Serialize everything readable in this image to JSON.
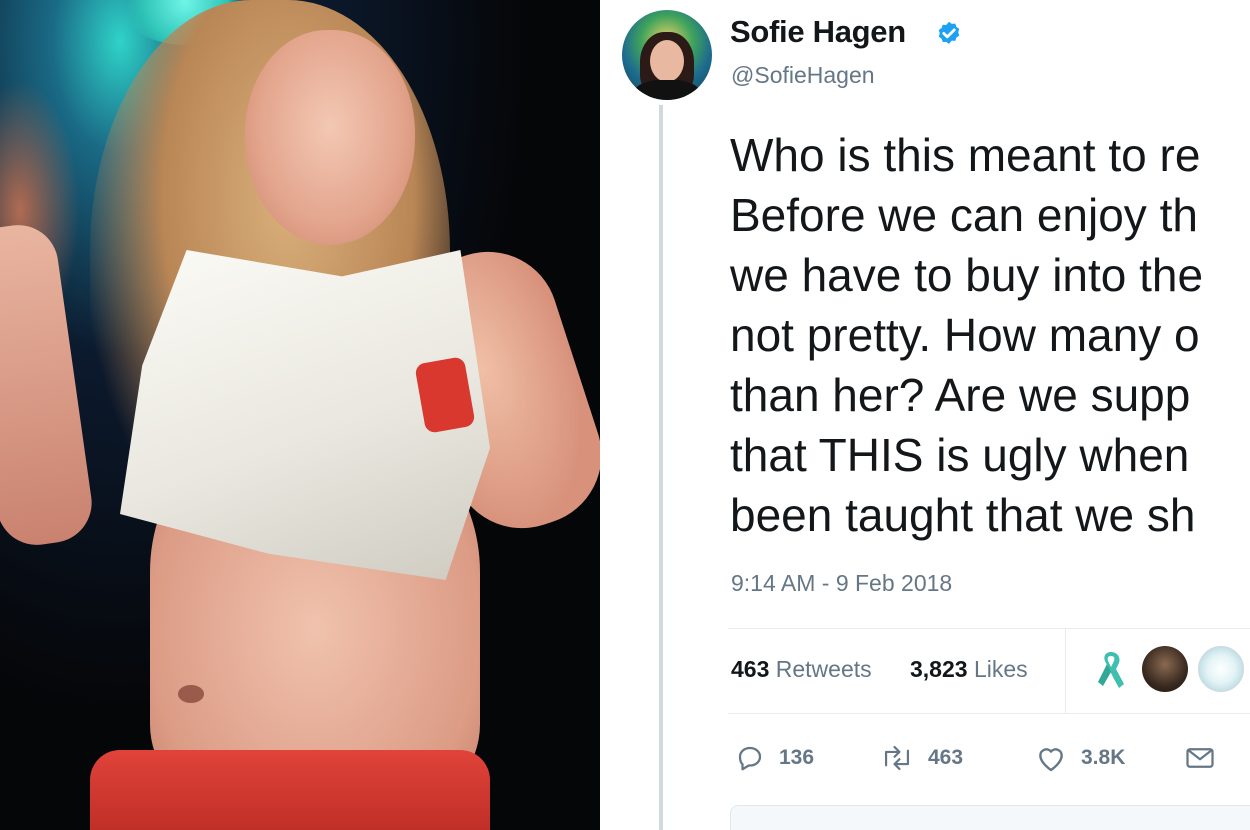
{
  "tweet": {
    "author_name": "Sofie Hagen",
    "author_handle": "@SofieHagen",
    "verified": true,
    "text_lines": [
      "Who is this meant to re",
      "Before we can enjoy th",
      "we have to buy into the",
      "not pretty. How many o",
      "than her? Are we supp",
      "that THIS is ugly when",
      "been taught that we sh"
    ],
    "timestamp": "9:14 AM - 9 Feb 2018",
    "retweets": {
      "count": "463",
      "label": "Retweets"
    },
    "likes": {
      "count": "3,823",
      "label": "Likes"
    },
    "actions": {
      "replies": "136",
      "retweets": "463",
      "likes": "3.8K"
    }
  },
  "colors": {
    "text": "#14171a",
    "muted": "#657786",
    "verified_blue": "#1da1f2",
    "ribbon_teal": "#3fbfae"
  },
  "icons": {
    "verified": "verified-badge-icon",
    "reply": "reply-icon",
    "retweet": "retweet-icon",
    "like": "heart-icon",
    "dm": "envelope-icon",
    "ribbon": "awareness-ribbon-icon"
  }
}
